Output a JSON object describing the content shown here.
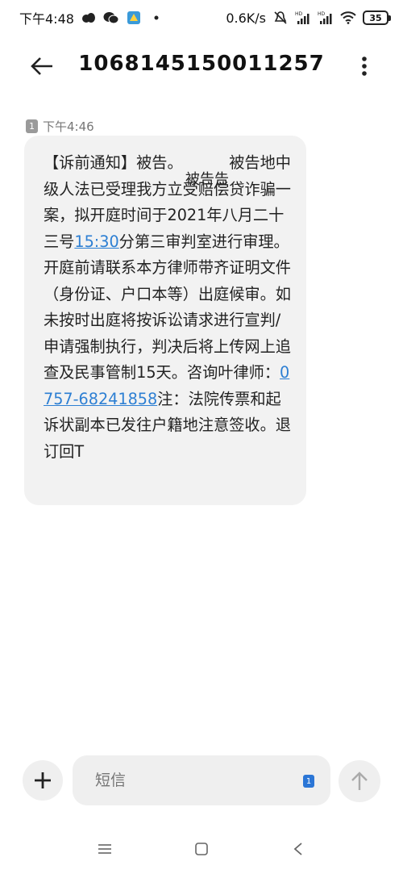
{
  "status_bar": {
    "time": "下午4:48",
    "network_speed": "0.6K/s",
    "battery_level": "35",
    "icons": [
      "app-icon-1",
      "wechat-icon",
      "app-icon-3",
      "dot-icon",
      "mute-icon",
      "signal-hd-icon",
      "signal-hd-icon-2",
      "wifi-icon",
      "battery-icon"
    ]
  },
  "header": {
    "title": "1068145150011257"
  },
  "message": {
    "sim_number": "1",
    "timestamp": "下午4:46",
    "text_1": "【诉前通知】被告。",
    "text_2": "被告地中级人法已受理我方立受赔偿贷诈骗一案，拟开庭时间于2021年八月二十三号",
    "link_time": "15:30",
    "text_3": "分第三审判室进行审理。开庭前请联系本方律师带齐证明文件（身份证、户口本等）出庭候审。如未按时出庭将按诉讼请求进行宣判/申请强制执行，判决后将上传网上追查及民事管制15天。咨询叶律师：",
    "link_phone": "0757-68241858",
    "text_4": "注：法院传票和起诉状副本已发往户籍地注意签收。退订回T",
    "overlay_text": "被告告"
  },
  "composer": {
    "placeholder": "短信",
    "sim_selector": "1"
  },
  "colors": {
    "link": "#2d7fd3",
    "bubble": "#f2f2f2",
    "accent": "#2b76d6"
  }
}
